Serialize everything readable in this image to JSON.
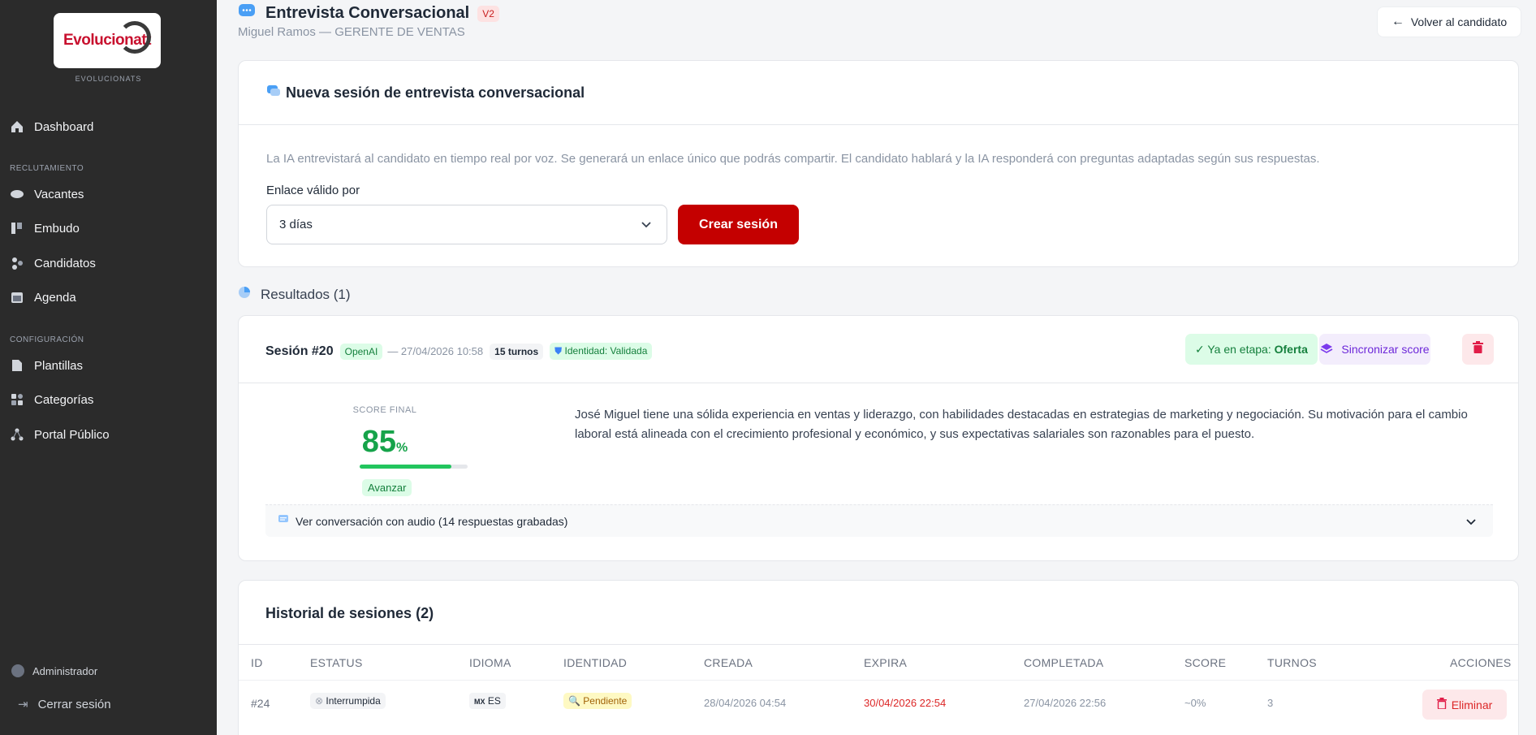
{
  "sidebar": {
    "logo_text": "Evolucionatt",
    "brand_caption": "EVOLUCIONATS",
    "items": [
      {
        "label": "Dashboard",
        "icon": "home-icon"
      },
      {
        "label": "Vacantes",
        "icon": "briefcase-icon"
      },
      {
        "label": "Embudo",
        "icon": "kanban-icon"
      },
      {
        "label": "Candidatos",
        "icon": "users-icon"
      },
      {
        "label": "Agenda",
        "icon": "calendar-icon"
      },
      {
        "label": "Plantillas",
        "icon": "file-icon"
      },
      {
        "label": "Categorías",
        "icon": "grid-icon"
      },
      {
        "label": "Portal Público",
        "icon": "share-icon"
      }
    ],
    "section_recruiting": "RECLUTAMIENTO",
    "section_config": "CONFIGURACIÓN",
    "user_label": "Administrador",
    "logout_label": "Cerrar sesión"
  },
  "header": {
    "title": "Entrevista Conversacional",
    "version_badge": "V2",
    "subtitle": "Miguel Ramos — GERENTE DE VENTAS",
    "back_label": "Volver al candidato"
  },
  "new_session": {
    "title": "Nueva sesión de entrevista conversacional",
    "description": "La IA entrevistará al candidato en tiempo real por voz. Se generará un enlace único que podrás compartir. El candidato hablará y la IA responderá con preguntas adaptadas según sus respuestas.",
    "valid_label": "Enlace válido por",
    "valid_value": "3 días",
    "create_label": "Crear sesión"
  },
  "results": {
    "title": "Resultados (1)",
    "session": {
      "id_label": "Sesión #20",
      "provider": "OpenAI",
      "datetime": "— 27/04/2026 10:58",
      "turns": "15 turnos",
      "identity": "Identidad: Validada",
      "stage_prefix": "✓ Ya en etapa:",
      "stage_value": "Oferta",
      "sync_label": "Sincronizar score",
      "score_label": "SCORE FINAL",
      "score_value": "85",
      "score_unit": "%",
      "score_fraction": 0.85,
      "verdict": "Avanzar",
      "summary": "José Miguel tiene una sólida experiencia en ventas y liderazgo, con habilidades destacadas en estrategias de marketing y negociación. Su motivación para el cambio laboral está alineada con el crecimiento profesional y económico, y sus expectativas salariales son razonables para el puesto.",
      "conversation_label": "Ver conversación con audio (14 respuestas grabadas)"
    }
  },
  "history": {
    "title": "Historial de sesiones (2)",
    "columns": [
      "ID",
      "ESTATUS",
      "IDIOMA",
      "IDENTIDAD",
      "CREADA",
      "EXPIRA",
      "COMPLETADA",
      "SCORE",
      "TURNOS",
      "ACCIONES"
    ],
    "rows": [
      {
        "id": "#24",
        "status": "Interrumpida",
        "lang": "ES",
        "lang_flag": "MX",
        "identity": "Pendiente",
        "created": "28/04/2026 04:54",
        "expires": "30/04/2026 22:54",
        "completed": "27/04/2026 22:56",
        "score": "~0%",
        "turns": "3",
        "action": "Eliminar"
      }
    ]
  },
  "colors": {
    "sidebar_bg": "#2b2b2b",
    "primary_red": "#c40000",
    "success_green": "#16a34a",
    "purple": "#6d28d9",
    "expire_red": "#dc2626"
  }
}
